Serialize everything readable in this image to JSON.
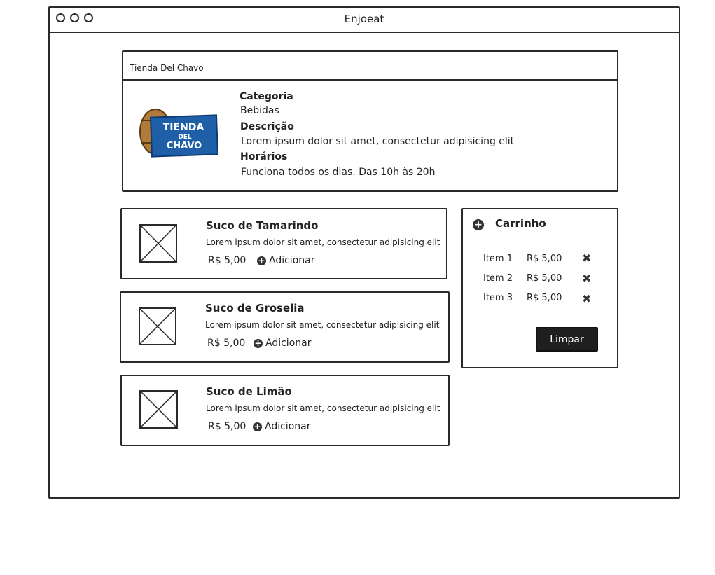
{
  "window": {
    "title": "Enjoeat"
  },
  "store": {
    "name": "Tienda Del Chavo",
    "logo_text": [
      "TIENDA",
      "DEL",
      "CHAVO"
    ],
    "category_label": "Categoria",
    "category_value": "Bebidas",
    "description_label": "Descrição",
    "description_value": "Lorem ipsum dolor sit amet, consectetur adipisicing elit",
    "hours_label": "Horários",
    "hours_value": "Funciona todos os dias. Das 10h às 20h"
  },
  "products": [
    {
      "name": "Suco de Tamarindo",
      "description": "Lorem ipsum dolor sit amet, consectetur adipisicing elit",
      "price": "R$ 5,00",
      "add_label": "Adicionar"
    },
    {
      "name": "Suco de Groselia",
      "description": "Lorem ipsum dolor sit amet, consectetur adipisicing elit",
      "price": "R$ 5,00",
      "add_label": "Adicionar"
    },
    {
      "name": "Suco de Limão",
      "description": "Lorem ipsum dolor sit amet, consectetur adipisicing elit",
      "price": "R$ 5,00",
      "add_label": "Adicionar"
    }
  ],
  "cart": {
    "title": "Carrinho",
    "items": [
      {
        "name": "Item 1",
        "price": "R$ 5,00"
      },
      {
        "name": "Item 2",
        "price": "R$ 5,00"
      },
      {
        "name": "Item 3",
        "price": "R$ 5,00"
      }
    ],
    "clear_label": "Limpar"
  },
  "icons": {
    "window_controls": "circle-icon",
    "add": "plus-circle-icon",
    "remove": "close-icon",
    "placeholder": "image-placeholder-icon"
  },
  "colors": {
    "stroke": "#2a2a2a",
    "button_bg": "#1f1f1f",
    "logo_blue": "#1e5fa8",
    "barrel": "#b07a3a"
  }
}
